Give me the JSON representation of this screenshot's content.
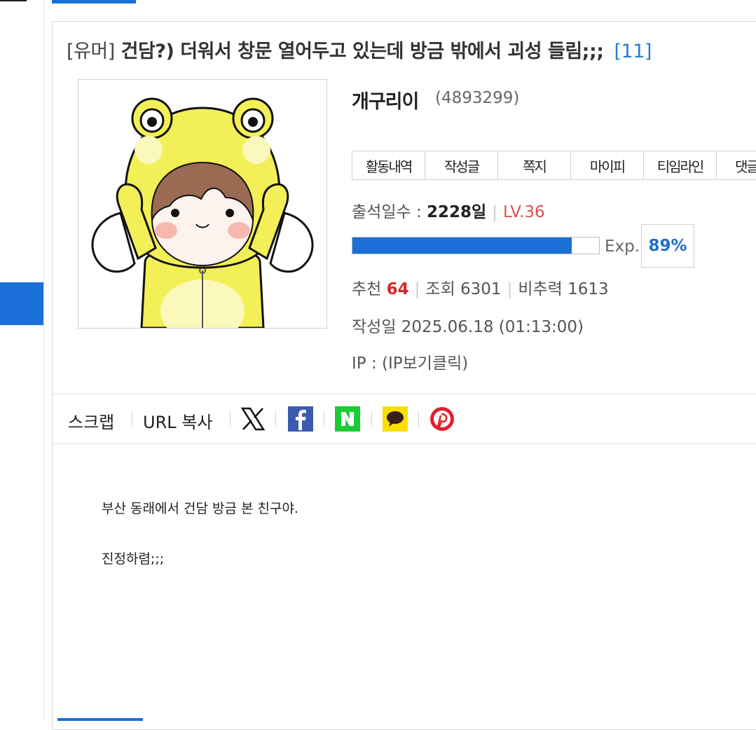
{
  "post": {
    "category": "[유머]",
    "title": "건담?) 더워서 창문 열어두고 있는데 방금 밖에서 괴성 들림;;;",
    "comment_count": "[11]"
  },
  "author": {
    "nickname": "개구리이",
    "user_id": "(4893299)",
    "avatar_icon": "frog-costume-character-avatar"
  },
  "menu": {
    "items": [
      "활동내역",
      "작성글",
      "쪽지",
      "마이피",
      "티임라인",
      "댓글"
    ]
  },
  "stats": {
    "attendance_label": "출석일수 :",
    "attendance_value": "2228일",
    "level": "LV.36",
    "exp_label": "Exp.",
    "exp_percent": "89%",
    "exp_fraction": 0.89,
    "recommend_label": "추천",
    "recommend_value": "64",
    "views": "조회 6301",
    "dislike": "비추력 1613",
    "written_date": "작성일 2025.06.18 (01:13:00)",
    "ip": "IP : (IP보기클릭)"
  },
  "share": {
    "scrap_label": "스크랩",
    "url_copy_label": "URL 복사",
    "icons": [
      "x-icon",
      "facebook-icon",
      "naver-icon",
      "kakaotalk-icon",
      "pinterest-icon"
    ]
  },
  "content": {
    "paragraphs": [
      "부산 동래에서 건담 방금 본 친구야.",
      "진정하렴;;;"
    ]
  },
  "colors": {
    "accent": "#1a6fd8",
    "level": "#d9534f",
    "recommend": "#d42a2a",
    "comment_count": "#2a7bd0"
  }
}
